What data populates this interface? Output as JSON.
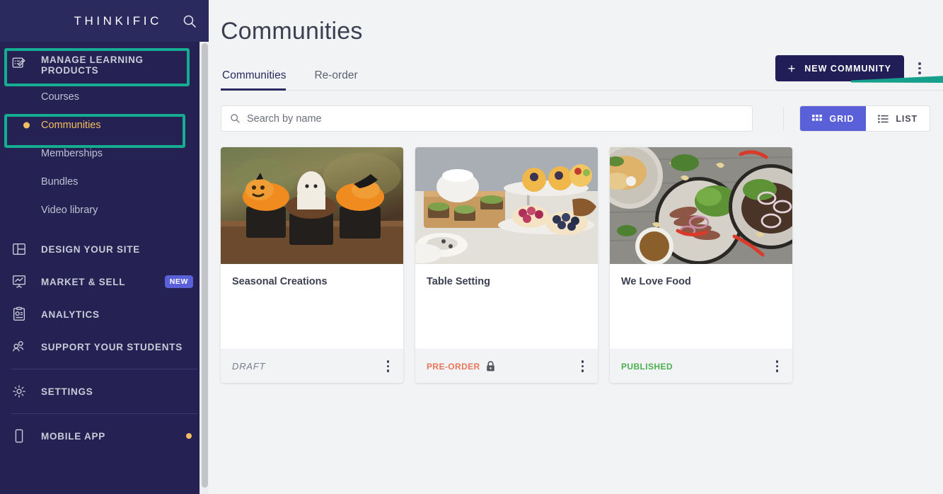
{
  "sidebar": {
    "brand": "THINKIFIC",
    "search_icon": "search-icon",
    "group": {
      "label": "MANAGE LEARNING PRODUCTS",
      "icon": "manage-learning-products-icon",
      "sub_items": [
        {
          "label": "Courses",
          "active": false
        },
        {
          "label": "Communities",
          "active": true
        },
        {
          "label": "Memberships",
          "active": false
        },
        {
          "label": "Bundles",
          "active": false
        },
        {
          "label": "Video library",
          "active": false
        }
      ]
    },
    "items": [
      {
        "label": "DESIGN YOUR SITE",
        "icon": "layout-icon",
        "badge": ""
      },
      {
        "label": "MARKET & SELL",
        "icon": "chart-presentation-icon",
        "badge": "NEW"
      },
      {
        "label": "ANALYTICS",
        "icon": "clipboard-chart-icon",
        "badge": ""
      },
      {
        "label": "SUPPORT YOUR STUDENTS",
        "icon": "people-icon",
        "badge": ""
      },
      {
        "label": "SETTINGS",
        "icon": "gear-icon",
        "badge": ""
      },
      {
        "label": "MOBILE APP",
        "icon": "mobile-phone-icon",
        "badge": ""
      }
    ]
  },
  "annotations": {
    "highlight_color": "#14ad92",
    "arrow_color": "#14a08a",
    "boxes": [
      "manage-learning-products",
      "communities"
    ],
    "arrow_points_to": "new-community-button"
  },
  "main": {
    "page_title": "Communities",
    "tabs": [
      {
        "label": "Communities",
        "active": true
      },
      {
        "label": "Re-order",
        "active": false
      }
    ],
    "new_community_button": {
      "label": "NEW COMMUNITY",
      "plus": "+"
    },
    "overflow_menu": "kebab-menu",
    "search": {
      "value": "",
      "placeholder": "Search by name",
      "icon": "search-icon"
    },
    "view_toggle": [
      {
        "label": "GRID",
        "icon": "grid-icon",
        "active": true
      },
      {
        "label": "LIST",
        "icon": "list-icon",
        "active": false
      }
    ],
    "cards": [
      {
        "title": "Seasonal Creations",
        "status": "DRAFT",
        "status_type": "draft",
        "status_color": "#7c7f8c",
        "locked": false,
        "image_alt": "halloween-cupcakes-photo"
      },
      {
        "title": "Table Setting",
        "status": "PRE-ORDER",
        "status_type": "preorder",
        "status_color": "#e8765a",
        "locked": true,
        "image_alt": "afternoon-tea-table-photo"
      },
      {
        "title": "We Love Food",
        "status": "PUBLISHED",
        "status_type": "published",
        "status_color": "#4caf50",
        "locked": false,
        "image_alt": "plated-meals-overhead-photo"
      }
    ]
  }
}
